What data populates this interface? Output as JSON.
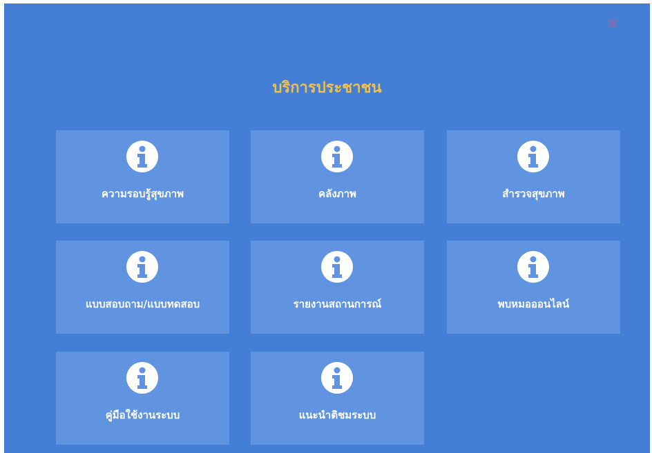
{
  "dialog": {
    "title": "บริการประชาชน",
    "close_icon": "close-icon",
    "colors": {
      "background": "#447ed5",
      "tile": "#6093e0",
      "title": "#f2c045",
      "close": "#7a6fb0"
    }
  },
  "tiles": [
    {
      "label": "ความรอบรู้สุขภาพ",
      "icon": "info-icon"
    },
    {
      "label": "คลังภาพ",
      "icon": "info-icon"
    },
    {
      "label": "สำรวจสุขภาพ",
      "icon": "info-icon"
    },
    {
      "label": "แบบสอบถาม/แบบทดสอบ",
      "icon": "info-icon"
    },
    {
      "label": "รายงานสถานการณ์",
      "icon": "info-icon"
    },
    {
      "label": "พบหมอออนไลน์",
      "icon": "info-icon"
    },
    {
      "label": "คู่มือใช้งานระบบ",
      "icon": "info-icon"
    },
    {
      "label": "แนะนำติชมระบบ",
      "icon": "info-icon"
    }
  ]
}
